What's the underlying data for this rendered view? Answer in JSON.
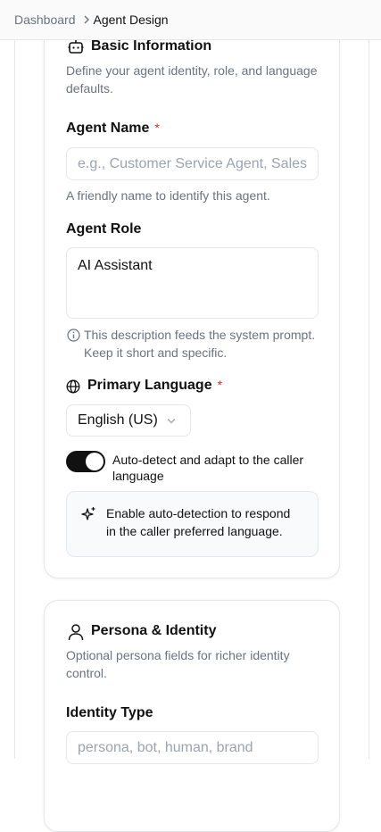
{
  "breadcrumb": {
    "parent": "Dashboard",
    "current": "Agent Design"
  },
  "basic_info": {
    "title": "Basic Information",
    "description": "Define your agent identity, role, and language defaults.",
    "agent_name": {
      "label": "Agent Name",
      "required_mark": "*",
      "placeholder": "e.g., Customer Service Agent, Sales",
      "helper": "A friendly name to identify this agent."
    },
    "agent_role": {
      "label": "Agent Role",
      "value": "AI Assistant",
      "hint": "This description feeds the system prompt. Keep it short and specific."
    },
    "primary_language": {
      "label": "Primary Language",
      "required_mark": "*",
      "selected": "English (US)"
    },
    "auto_detect": {
      "label": "Auto-detect and adapt to the caller language",
      "enabled": true
    },
    "auto_detect_info": "Enable auto-detection to respond in the caller preferred language."
  },
  "persona": {
    "title": "Persona & Identity",
    "description": "Optional persona fields for richer identity control.",
    "identity_type": {
      "label": "Identity Type",
      "placeholder": "persona, bot, human, brand"
    }
  },
  "colors": {
    "accent": "#111111",
    "required": "#dc2626",
    "muted_text": "#6b7280",
    "border": "#e5e7eb"
  }
}
